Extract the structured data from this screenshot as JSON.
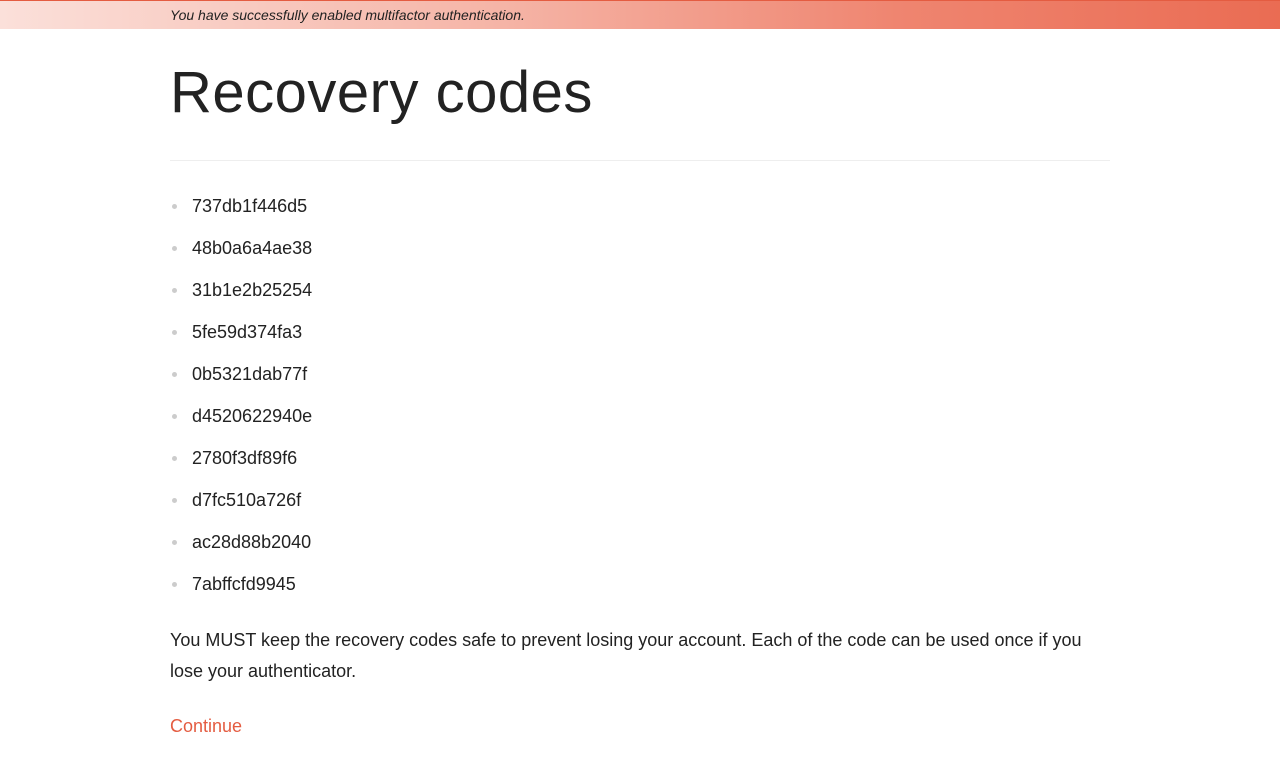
{
  "banner": {
    "message": "You have successfully enabled multifactor authentication."
  },
  "page": {
    "title": "Recovery codes",
    "codes": [
      "737db1f446d5",
      "48b0a6a4ae38",
      "31b1e2b25254",
      "5fe59d374fa3",
      "0b5321dab77f",
      "d4520622940e",
      "2780f3df89f6",
      "d7fc510a726f",
      "ac28d88b2040",
      "7abffcfd9945"
    ],
    "instructions": "You MUST keep the recovery codes safe to prevent losing your account. Each of the code can be used once if you lose your authenticator.",
    "continue_label": "Continue"
  }
}
